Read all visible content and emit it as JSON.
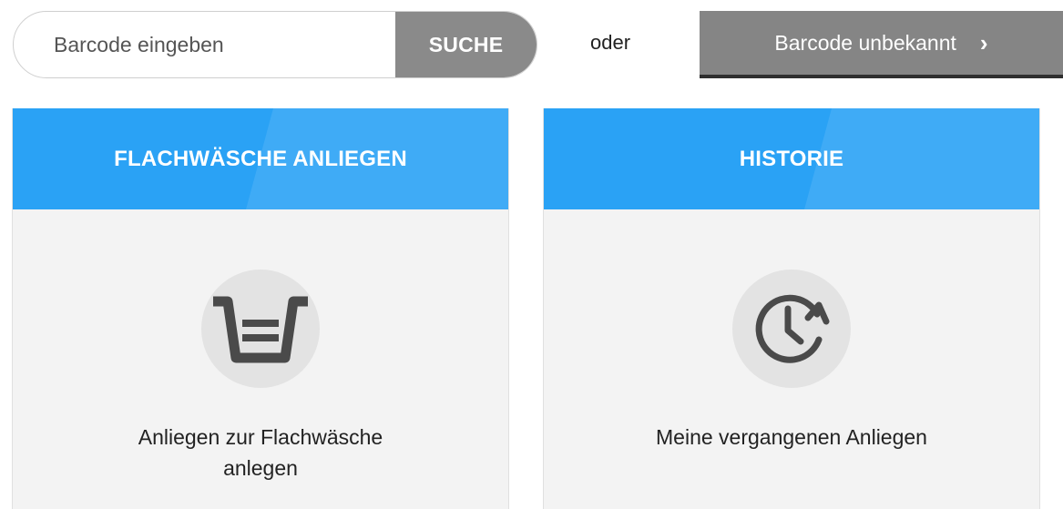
{
  "search": {
    "placeholder": "Barcode eingeben",
    "button_label": "SUCHE"
  },
  "or_label": "oder",
  "unknown_button": {
    "label": "Barcode unbekannt",
    "chevron": "›"
  },
  "cards": [
    {
      "title": "FLACHWÄSCHE ANLIEGEN",
      "icon": "basket-icon",
      "text_line1": "Anliegen zur Flachwäsche",
      "text_line2": "anlegen"
    },
    {
      "title": "HISTORIE",
      "icon": "history-icon",
      "text_line1": "Meine vergangenen Anliegen"
    }
  ],
  "colors": {
    "header_blue": "#2aa2f5",
    "button_gray": "#8a8a8a",
    "card_bg": "#f3f3f3",
    "icon_circle": "#e3e3e3",
    "icon_dark": "#4a4a4a"
  }
}
